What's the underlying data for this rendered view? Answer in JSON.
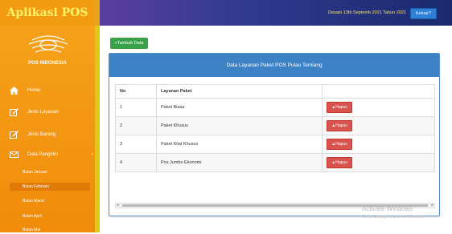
{
  "app": {
    "title": "Aplikasi POS"
  },
  "header": {
    "date_text": "Desain 13th Septemb 2021 Tahun 2021",
    "logout_label": "Keluar?"
  },
  "logo": {
    "text": "POS INDONESIA"
  },
  "sidebar": {
    "items": [
      {
        "label": "Home",
        "icon": "home-icon"
      },
      {
        "label": "Jenis Layanan",
        "icon": "edit-icon"
      },
      {
        "label": "Jenis Barang",
        "icon": "edit-icon"
      },
      {
        "label": "Data Pengirim",
        "icon": "envelope-icon",
        "caret": "‹"
      }
    ],
    "subitems": [
      "Bulan Januari",
      "Bulan Februari",
      "Bulan Maret",
      "Bulan April",
      "Bulan Mei"
    ]
  },
  "main": {
    "add_button": "+Tambah Data",
    "panel_title": "Data Layanan Paket POS Pulau Temiang",
    "table": {
      "headers": [
        "No",
        "Layanan Paket",
        ""
      ],
      "rows": [
        {
          "no": "1",
          "name": "Paket Biasa",
          "action": "Hapus"
        },
        {
          "no": "2",
          "name": "Paket Khusus",
          "action": "Hapus"
        },
        {
          "no": "3",
          "name": "Paket Kilat Khusus",
          "action": "Hapus"
        },
        {
          "no": "4",
          "name": "Pos Jumbo Ekonomi",
          "action": "Hapus"
        }
      ]
    }
  },
  "watermark": {
    "title": "Activate Windows",
    "subtitle": "Go to Settings to activate Windows."
  },
  "colors": {
    "sidebar": "#f39c12",
    "accent": "#3d82c4",
    "danger": "#d9534f",
    "success": "#3aa14a"
  }
}
